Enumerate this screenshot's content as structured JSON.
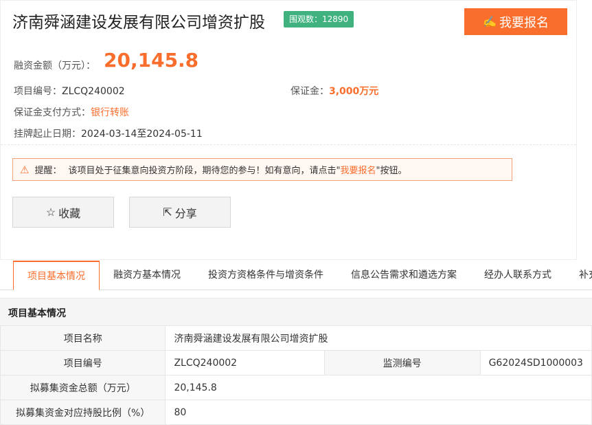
{
  "project": {
    "title": "济南舜涵建设发展有限公司增资扩股",
    "views_label": "围观数：",
    "views_count": "12890",
    "signup_label": "我要报名",
    "amount_label": "融资金额（万元）：",
    "amount_value": "20,145.8",
    "code_label": "项目编号：",
    "code_value": "ZLCQ240002",
    "deposit_label": "保证金：",
    "deposit_value": "3,000万元",
    "payment_label": "保证金支付方式：",
    "payment_value": "银行转账",
    "date_label": "挂牌起止日期：",
    "date_value": "2024-03-14至2024-05-11"
  },
  "notice": {
    "prefix": "提醒：",
    "text_before": "该项目处于征集意向投资方阶段，期待您的参与！如有意向，请点击\"",
    "link": "我要报名",
    "text_after": "\"按钮。"
  },
  "actions": {
    "favorite_label": "收藏",
    "share_label": "分享"
  },
  "tabs": [
    {
      "label": "项目基本情况"
    },
    {
      "label": "融资方基本情况"
    },
    {
      "label": "投资方资格条件与增资条件"
    },
    {
      "label": "信息公告需求和遴选方案"
    },
    {
      "label": "经办人联系方式"
    },
    {
      "label": "补充"
    }
  ],
  "section": {
    "title": "项目基本情况",
    "rows": [
      {
        "label": "项目名称",
        "value": "济南舜涵建设发展有限公司增资扩股"
      },
      {
        "label": "项目编号",
        "value": "ZLCQ240002",
        "label2": "监测编号",
        "value2": "G62024SD1000003"
      },
      {
        "label": "拟募集资金总额（万元）",
        "value": "20,145.8"
      },
      {
        "label": "拟募集资金对应持股比例（%）",
        "value": "80"
      }
    ]
  },
  "colors": {
    "accent": "#fa6e2d",
    "badge": "#3fb27f"
  }
}
